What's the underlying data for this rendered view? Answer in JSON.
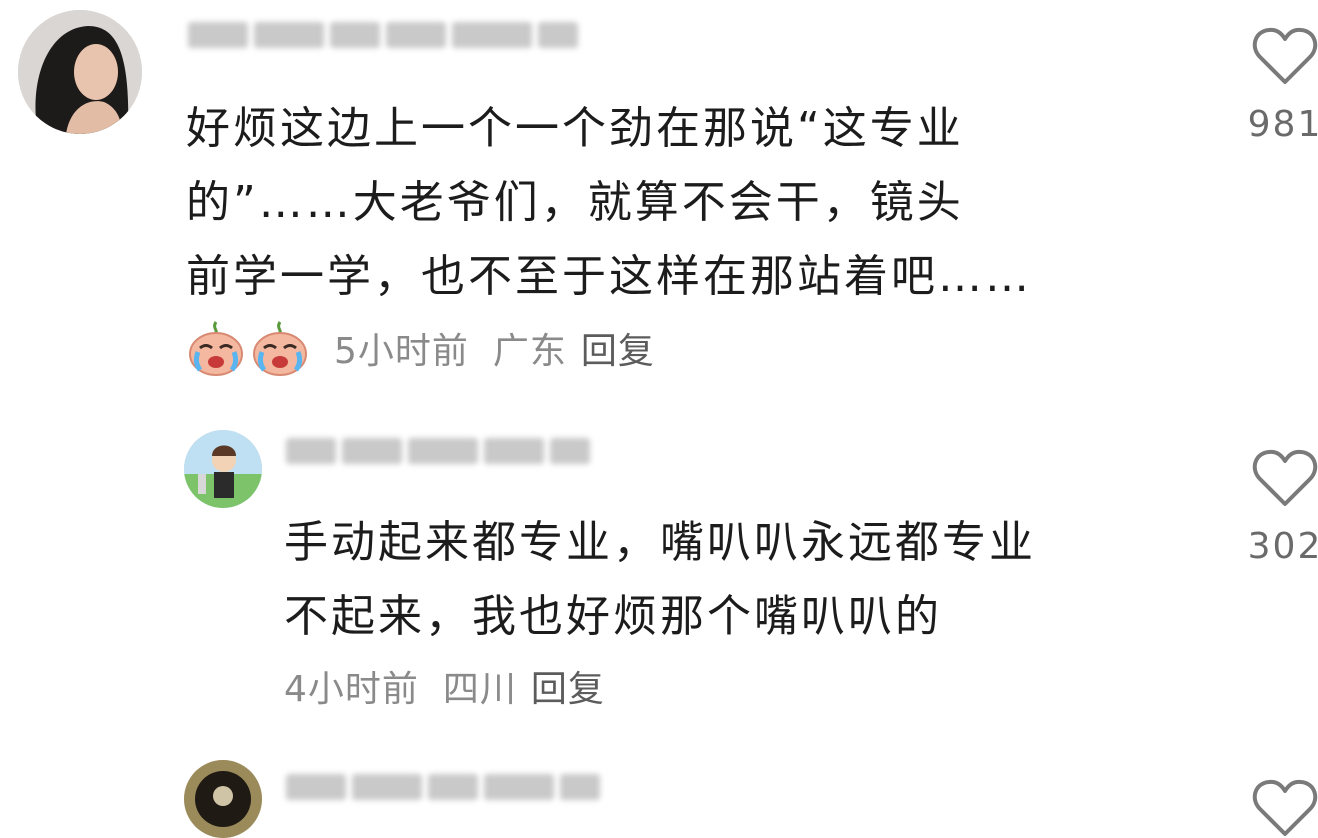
{
  "comments": [
    {
      "text": "好烦这边上一个一个劲在那说“这专业\n的”……大老爷们，就算不会干，镜头\n前学一学，也不至于这样在那站着吧……",
      "time": "5小时前",
      "location": "广东",
      "reply_label": "回复",
      "emoji_icons": [
        "crying-face-icon",
        "crying-face-icon"
      ],
      "likes": "981"
    },
    {
      "text": "手动起来都专业，嘴叭叭永远都专业\n不起来，我也好烦那个嘴叭叭的",
      "time": "4小时前",
      "location": "四川",
      "reply_label": "回复",
      "likes": "302"
    },
    {
      "text": "",
      "likes": ""
    }
  ],
  "colors": {
    "text": "#1c1c1c",
    "meta": "#8a8a8a",
    "heart_stroke": "#7a7a7a",
    "blur": "#c9c9c9"
  },
  "icons": {
    "like": "heart-outline-icon"
  }
}
